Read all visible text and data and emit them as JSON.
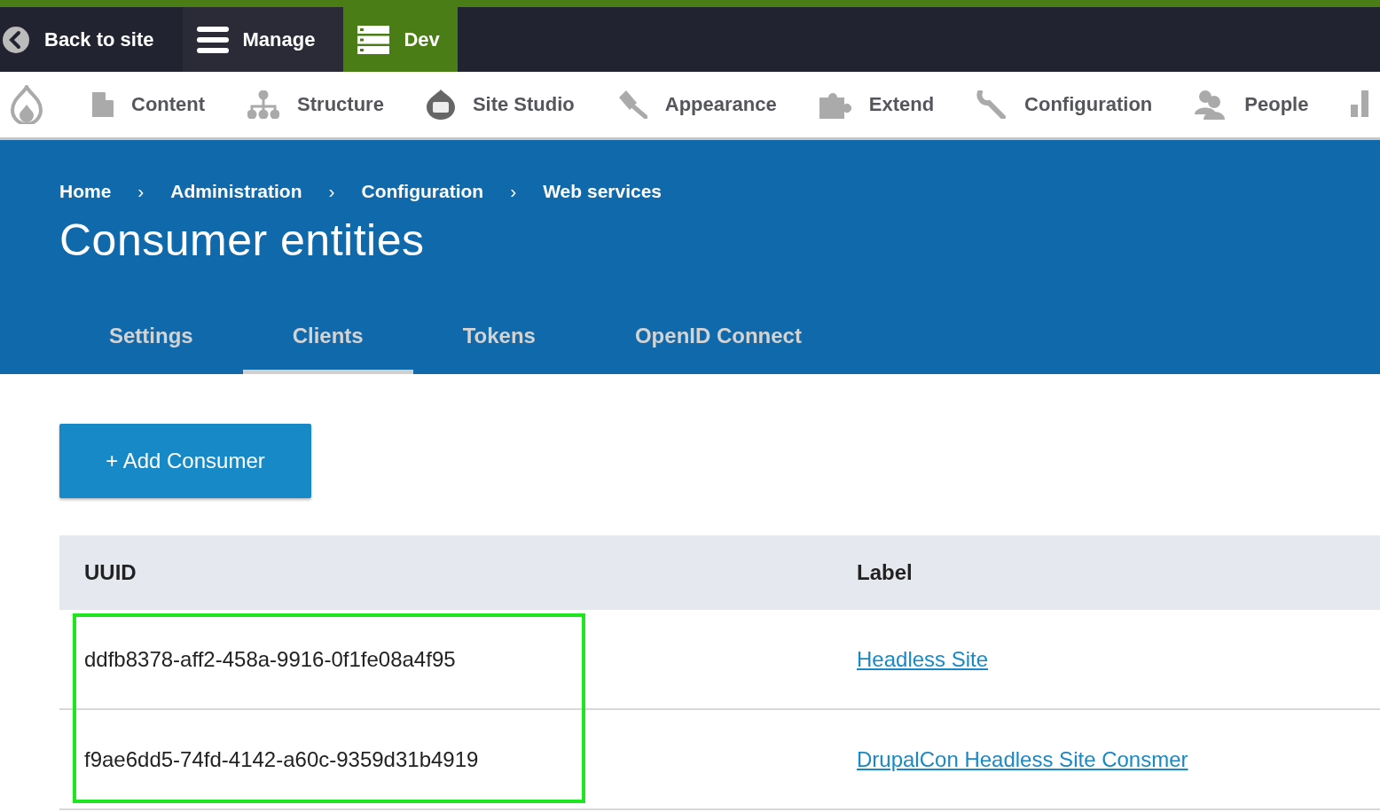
{
  "admin_bar": [
    {
      "label": "Back to site",
      "selected": false
    },
    {
      "label": "Manage",
      "selected": false
    },
    {
      "label": "Dev",
      "selected": true
    }
  ],
  "toolbar": {
    "items": [
      {
        "label": "Content"
      },
      {
        "label": "Structure"
      },
      {
        "label": "Site Studio"
      },
      {
        "label": "Appearance"
      },
      {
        "label": "Extend"
      },
      {
        "label": "Configuration"
      },
      {
        "label": "People"
      }
    ]
  },
  "breadcrumb": [
    "Home",
    "Administration",
    "Configuration",
    "Web services"
  ],
  "breadcrumb_separator": "›",
  "page_title": "Consumer entities",
  "tabs": [
    {
      "label": "Settings",
      "selected": false
    },
    {
      "label": "Clients",
      "selected": true
    },
    {
      "label": "Tokens",
      "selected": false
    },
    {
      "label": "OpenID Connect",
      "selected": false
    }
  ],
  "add_button": "+ Add Consumer",
  "table": {
    "columns": [
      "UUID",
      "Label"
    ],
    "uuid_highlighted": true,
    "rows": [
      {
        "uuid": "ddfb8378-aff2-458a-9916-0f1fe08a4f95",
        "label": "Headless Site"
      },
      {
        "uuid": "f9ae6dd5-74fd-4142-a60c-9359d31b4919",
        "label": "DrupalCon Headless Site Consmer"
      }
    ]
  }
}
